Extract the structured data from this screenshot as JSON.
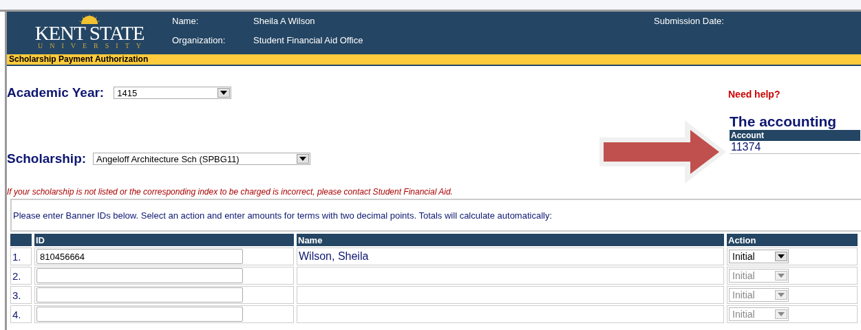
{
  "header": {
    "logo": {
      "wordmark": "KENT STATE",
      "subtitle": "UNIVERSITY"
    },
    "fields": [
      {
        "label": "Name:",
        "value": "Sheila A Wilson"
      },
      {
        "label": "Organization:",
        "value": "Student Financial Aid Office"
      }
    ],
    "submission_date": {
      "label": "Submission Date:"
    }
  },
  "page_title": "Scholarship Payment Authorization",
  "academic_year": {
    "label": "Academic Year:",
    "value": "1415"
  },
  "scholarship": {
    "label": "Scholarship:",
    "value": "Angeloff Architecture Sch (SPBG11)"
  },
  "help_link": "Need help?",
  "accounting": {
    "heading": "The accounting",
    "column": "Account",
    "value": "11374"
  },
  "notice": "If your scholarship is not listed or the corresponding index to be charged is incorrect, please contact Student Financial Aid.",
  "instructions": "Please enter Banner IDs below. Select an action and enter amounts for terms with two decimal points.  Totals will calculate automatically:",
  "table": {
    "columns": [
      "ID",
      "Name",
      "Action"
    ],
    "rows": [
      {
        "number": "1.",
        "id": "810456664",
        "name": "Wilson, Sheila",
        "action": "Initial",
        "disabled": false
      },
      {
        "number": "2.",
        "action": "Initial",
        "disabled": true
      },
      {
        "number": "3.",
        "action": "Initial",
        "disabled": true
      },
      {
        "number": "4.",
        "action": "Initial",
        "disabled": true
      }
    ]
  }
}
